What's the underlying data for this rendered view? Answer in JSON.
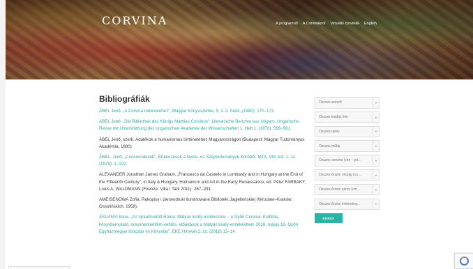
{
  "header": {
    "logo_small": "",
    "logo_main": "CORVINA",
    "nav": [
      "A programról",
      "A Corvinákról",
      "Virtuális corvinák",
      "English"
    ]
  },
  "main": {
    "title": "Bibliográfiák",
    "entries": [
      {
        "color": "teal",
        "text": "ÁBEL Jenő, „A Corvina történetéhez\", Magyar Könyvszemle, 5, 2–3. füzet, (1880): 170–173."
      },
      {
        "color": "teal",
        "text": "ÁBEL Jenő, „Die Bibliothek des Königs Mathias Corvinus\", Literarische Berichte aus Ungarn. Ungarische Revue mit Unterstützung der Ungarischen Akademie der Wissenschaften 1, Heft 1. (1878): 556–581."
      },
      {
        "color": "dark",
        "text": "ÁBEL Jenő, szerk. Adalékok a humanismus történetéhez Magyarországon (Budapest: Magyar Tudományos Akadémia, 1880)"
      },
      {
        "color": "teal",
        "text": "ÁBEL, Jenő, „Corvincodexek\", Értekezések a Nyelv- és Széptudományok Köréből, MTA, VIII. köt. 1. sz. (1879): 1–102."
      },
      {
        "color": "dark",
        "text": "ALEXANDER Jonathan James Graham, „Francesco da Castello in Lombardy and in Hungary at the End of the Fifteenth Century\", in Italy & Hungary. Humanism and Art in the Early Renaissance, ed. Péter FARBAKY, Louis A. WALDMANN (Firenze, Villa I Tatti 2011): 267–291."
      },
      {
        "color": "dark",
        "text": "AMEISENOWA Zofia, Rękopisy i pierwodruki iluminowane Biblioteki Jagiellońskiej (Wrocław–Kraków: Ossolińskich, 1958)."
      },
      {
        "color": "teal",
        "text": "ÁSVÁNYI Ilona, „Az újraálmodott Róma: Mátyás király emlékezete – a Győri Corvina. Kiállítás, könyvbemutató, dokumentumfilm-vetítés, előadások a Mátyás király-emlékévben: 2018. május 18. Győri Egyházmegyei Kincstár és Könyvtár\", EKE Hírlevél 2. sz. (2018) 13–14."
      }
    ]
  },
  "filters": {
    "selects": [
      "Összes szerző",
      "Összes kiadás éve",
      "Összes nyelv",
      "Összes műfaj",
      "Összes corvina (cím – jel...",
      "Összes őrzési ország (co...",
      "Összes őrzési város (cor...",
      "Összes őrzési intézmény..."
    ],
    "search_button": "KERES"
  },
  "colors": {
    "accent": "#2bb3a6",
    "link": "#2fa9a0"
  }
}
